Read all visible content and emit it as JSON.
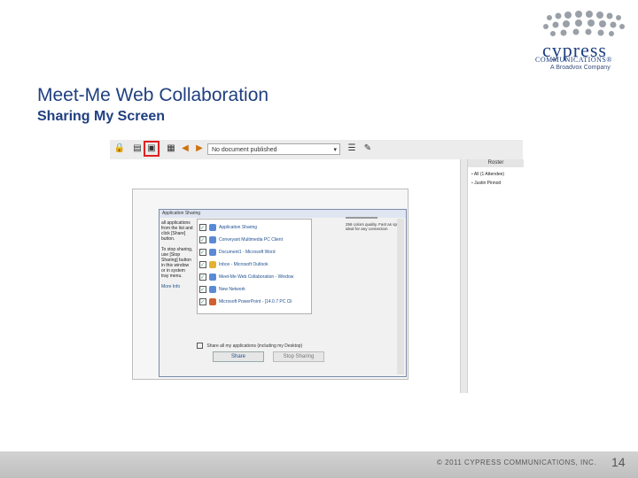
{
  "slide": {
    "title": "Meet-Me Web Collaboration",
    "subtitle": "Sharing My Screen"
  },
  "logo": {
    "word": "cypress",
    "sub1": "COMMUNICATIONS®",
    "sub2": "A Broadvox Company"
  },
  "toolbar": {
    "document_select": "No document published",
    "dropdown_arrow": "▾"
  },
  "side_panel": {
    "header": "Roster",
    "rows": [
      "All (1 Attendee)",
      "Justin Pinnod"
    ]
  },
  "dialog": {
    "title": "Application Sharing",
    "left_text": "all applications from the list and click [Share] button.",
    "left_text2": "To stop sharing, use [Stop Sharing] button in this window or in system tray menu.",
    "more_link": "More Info",
    "apps": [
      "Application Sharing",
      "Conveyant Multimedia PC Client",
      "Document1 - Microsoft Word",
      "Inbox - Microsoft Outlook",
      "Meet-Me Web Collaboration - Window",
      "New Network",
      "Microsoft PowerPoint - [14.0.7 PC Cli"
    ],
    "quality_text": "256 colors quality. Fast as speed ideal for any connection",
    "share_all_label": "Share all my applications (including my Desktop)",
    "share_button": "Share",
    "stop_button": "Stop Sharing"
  },
  "footer": {
    "copyright": "© 2011 CYPRESS COMMUNICATIONS, INC.",
    "page_number": "14"
  },
  "colors": {
    "title_blue": "#1f3f7f",
    "highlight_red": "#e02020",
    "footer_gray": "#c8c8c8"
  }
}
